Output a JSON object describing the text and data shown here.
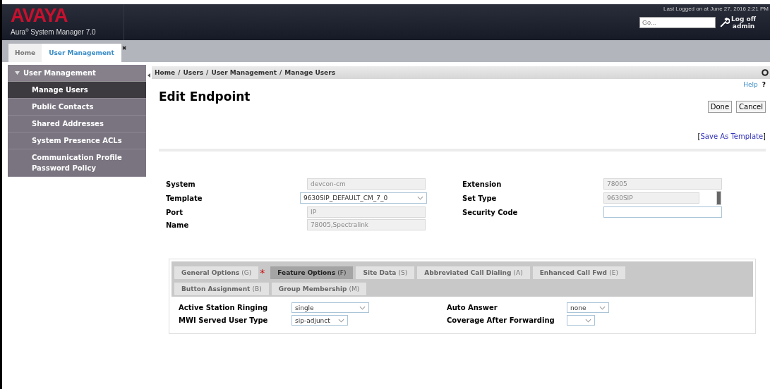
{
  "header": {
    "logo": "AVAYA",
    "product": "Aura",
    "product_mark": "®",
    "product_rest": " System Manager 7.0",
    "last_login": "Last Logged on at June 27, 2016 2:21 PM",
    "search": {
      "placeholder": "Go..."
    },
    "logoff": "Log off",
    "user": "admin"
  },
  "tabs": [
    {
      "label": "Home",
      "selected": false,
      "closable": false
    },
    {
      "label": "User Management",
      "selected": true,
      "closable": true
    }
  ],
  "close_mark": "✖",
  "sidebar": {
    "title": "User Management",
    "expanded": true,
    "items": [
      {
        "label": "Manage Users",
        "selected": true
      },
      {
        "label": "Public Contacts",
        "selected": false
      },
      {
        "label": "Shared Addresses",
        "selected": false
      },
      {
        "label": "System Presence ACLs",
        "selected": false
      },
      {
        "label": "Communication Profile Password Policy",
        "selected": false
      }
    ]
  },
  "breadcrumb": [
    "Home",
    "Users",
    "User Management",
    "Manage Users"
  ],
  "breadcrumb_separator": "/",
  "help": "Help",
  "help_mark": "?",
  "title": "Edit Endpoint",
  "buttons": [
    "Done",
    "Cancel"
  ],
  "save_template": {
    "open": "[",
    "label": "Save As Template",
    "close": "]"
  },
  "fields": [
    {
      "label": "System",
      "value": "devcon-cm",
      "kind": "text",
      "disabled": true
    },
    {
      "label": "Extension",
      "value": "78005",
      "kind": "text",
      "disabled": true
    },
    {
      "label": "Template",
      "value": "9630SIP_DEFAULT_CM_7_0",
      "kind": "select"
    },
    {
      "label": "Set Type",
      "value": "9630SIP",
      "kind": "text",
      "disabled": true
    },
    {
      "label": "Port",
      "value": "IP",
      "kind": "text",
      "disabled": true
    },
    {
      "label": "Security Code",
      "kind": "text",
      "disabled": false
    },
    {
      "label": "Name",
      "value": "78005,Spectralink",
      "kind": "text",
      "disabled": true
    }
  ],
  "option_tabs": [
    {
      "label": "General Options",
      "key": "(G)",
      "selected": false,
      "required": true
    },
    {
      "label": "Feature Options",
      "key": "(F)",
      "selected": true,
      "required": false
    },
    {
      "label": "Site Data",
      "key": "(S)",
      "selected": false,
      "required": false
    },
    {
      "label": "Abbreviated Call Dialing",
      "key": "(A)",
      "selected": false,
      "required": false
    },
    {
      "label": "Enhanced Call Fwd",
      "key": "(E)",
      "selected": false,
      "required": false
    },
    {
      "label": "Button Assignment",
      "key": "(B)",
      "selected": false,
      "required": false
    },
    {
      "label": "Group Membership",
      "key": "(M)",
      "selected": false,
      "required": false
    }
  ],
  "required_mark": "*",
  "options": [
    {
      "label": "Active Station Ringing",
      "value": "single"
    },
    {
      "label": "Auto Answer",
      "value": "none"
    },
    {
      "label": "MWI Served User Type",
      "value": "sip-adjunct"
    },
    {
      "label": "Coverage After Forwarding"
    }
  ]
}
